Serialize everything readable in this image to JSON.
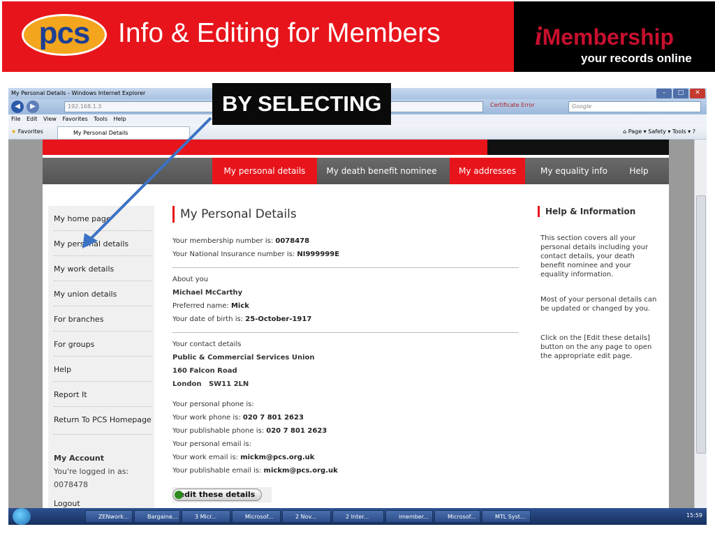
{
  "slide": {
    "logo_text": "pcs",
    "title": "Info & Editing for Members",
    "brand_i": "i",
    "brand_rest": "Membership",
    "brand_tagline": "your records online",
    "callout": "BY SELECTING"
  },
  "browser": {
    "window_title": "My Personal Details - Windows Internet Explorer",
    "address": "192.168.1.3",
    "cert_error": "Certificate Error",
    "search_placeholder": "Google",
    "menu": [
      "File",
      "Edit",
      "View",
      "Favorites",
      "Tools",
      "Help"
    ],
    "favorites_label": "Favorites",
    "tab_label": "My Personal Details",
    "command_bar": "Page ▾  Safety ▾  Tools ▾"
  },
  "nav": {
    "items": [
      {
        "label": "My personal details",
        "active": true
      },
      {
        "label": "My death benefit nominee",
        "active": false
      },
      {
        "label": "My addresses",
        "active": true
      },
      {
        "label": "My equality info",
        "active": false
      },
      {
        "label": "Help",
        "active": false
      }
    ]
  },
  "sidebar": {
    "items": [
      "My home page",
      "My personal details",
      "My work details",
      "My union details",
      "For branches",
      "For groups",
      "Help",
      "Report It",
      "Return To PCS Homepage"
    ],
    "account_heading": "My Account",
    "logged_in_label": "You're logged in as:",
    "logged_in_id": "0078478",
    "logout": "Logout"
  },
  "main": {
    "title": "My Personal Details",
    "membership_label": "Your membership number is: ",
    "membership_value": "0078478",
    "ni_label": "Your National Insurance number is: ",
    "ni_value": "NI999999E",
    "about_label": "About you",
    "name": "Michael McCarthy",
    "preferred_label": "Preferred name: ",
    "preferred_value": "Mick",
    "dob_label": "Your date of birth is: ",
    "dob_value": "25-October-1917",
    "contact_label": "Your contact details",
    "address1": "Public & Commercial Services Union",
    "address2": "160 Falcon Road",
    "address3": "London   SW11 2LN",
    "personal_phone_label": "Your personal phone is:",
    "work_phone_label": "Your work phone is: ",
    "work_phone_value": "020 7 801 2623",
    "pub_phone_label": "Your publishable phone is: ",
    "pub_phone_value": "020 7 801 2623",
    "personal_email_label": "Your personal email is:",
    "work_email_label": "Your work email is: ",
    "work_email_value": "mickm@pcs.org.uk",
    "pub_email_label": "Your publishable email is: ",
    "pub_email_value": "mickm@pcs.org.uk",
    "edit_button": "edit these details"
  },
  "help": {
    "title": "Help & Information",
    "p1": "This section covers all your personal details including your contact details, your death benefit nominee and your equality information.",
    "p2": "Most of your personal details can be updated or changed by you.",
    "p3": "Click on the [Edit these details] button on the any page to open the appropriate edit page."
  },
  "taskbar": {
    "items": [
      "ZENwork...",
      "Bargaine...",
      "3 Micr...",
      "Microsof...",
      "2 Nov...",
      "2 Inter...",
      "imember...",
      "Microsof...",
      "MTL Syst..."
    ],
    "clock": "15:59"
  },
  "colors": {
    "pcs_red": "#e8141b",
    "nav_grey": "#5e5e5e",
    "brand_red": "#c8102e"
  }
}
